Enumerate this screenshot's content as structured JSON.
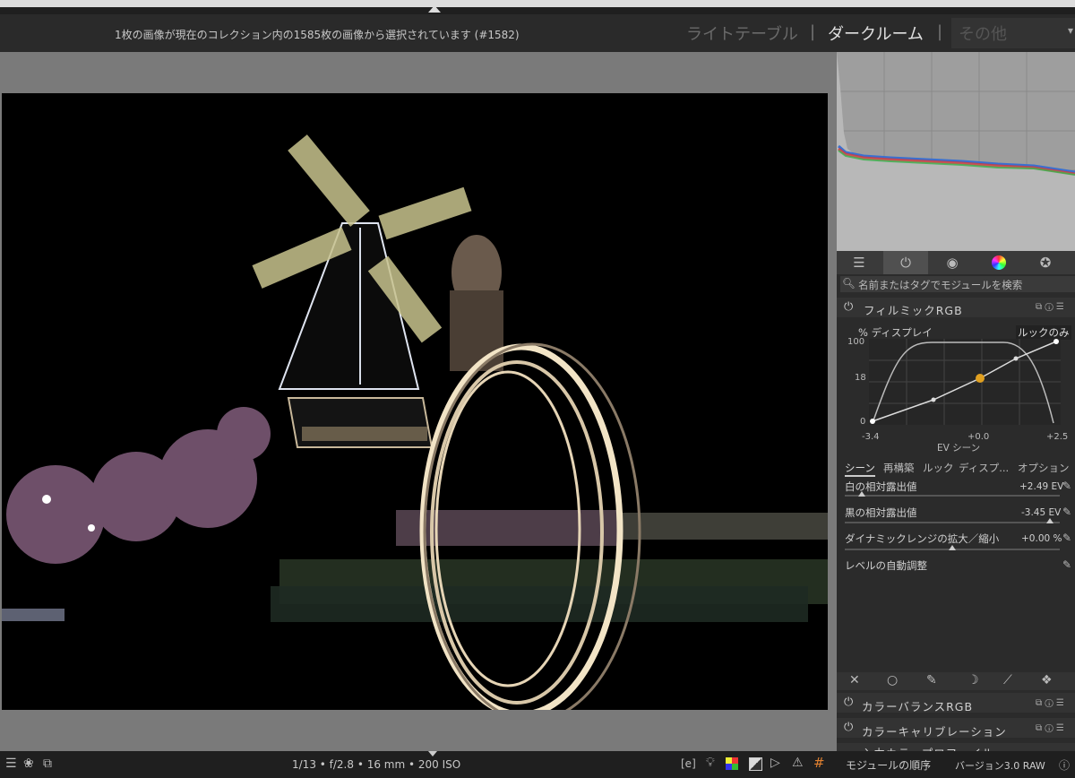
{
  "header": {
    "info": "1枚の画像が現在のコレクション内の1585枚の画像から選択されています (#1582)",
    "views": {
      "lighttable": "ライトテーブル",
      "darkroom": "ダークルーム",
      "other": "その他"
    },
    "separator": "|"
  },
  "search": {
    "placeholder": "名前またはタグでモジュールを検索"
  },
  "filmic": {
    "title": "フィルミックRGB",
    "graph_label": "% ディスプレイ",
    "look_label": "ルックのみ",
    "y_ticks": [
      "100",
      "18",
      "0"
    ],
    "x_ticks": [
      "-3.4",
      "+0.0",
      "+2.5"
    ],
    "x_caption": "EV  シーン",
    "tabs": [
      "シーン",
      "再構築",
      "ルック",
      "ディスプ...",
      "オプション"
    ],
    "params": [
      {
        "label": "白の相対露出値",
        "value": "+2.49 EV",
        "position": 0.12
      },
      {
        "label": "黒の相対露出値",
        "value": "-3.45 EV",
        "position": 0.93
      },
      {
        "label": "ダイナミックレンジの拡大／縮小",
        "value": "+0.00 %",
        "position": 0.5
      }
    ],
    "auto_level": "レベルの自動調整"
  },
  "modules": [
    {
      "title": "カラーバランスRGB"
    },
    {
      "title": "カラーキャリブレーション"
    },
    {
      "title": "入力カラープロファイル"
    }
  ],
  "bottombar": {
    "exif": "1/13 • f/2.8 • 16 mm • 200 ISO",
    "module_order_label": "モジュールの順序",
    "module_order_value": "バージョン3.0 RAW"
  }
}
